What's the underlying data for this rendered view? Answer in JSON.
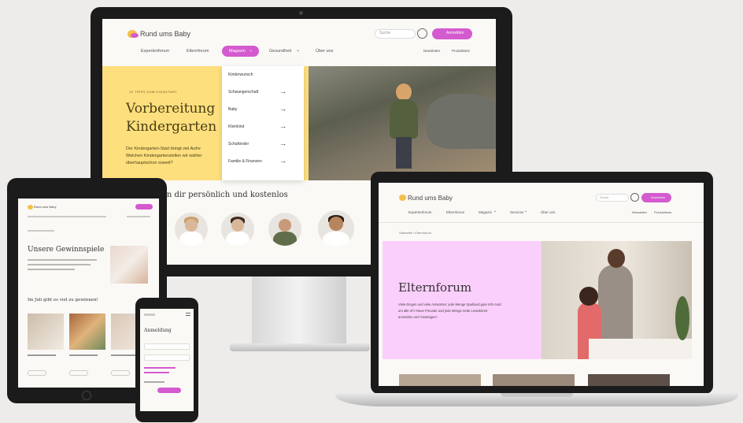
{
  "brand": "Rund ums Baby",
  "colors": {
    "accent": "#d45ad0",
    "yellow": "#fddf7e",
    "pink": "#fbcffb",
    "frame": "#1b1b1b"
  },
  "monitor": {
    "search_placeholder": "Suche",
    "login_label": "Anmelden",
    "nav": [
      "Expertenforum",
      "Elternforum",
      "Magazin",
      "Gesundheit",
      "Über uns"
    ],
    "nav_right": [
      "Newsletter",
      "Produkttest"
    ],
    "dropdown": [
      "Kinderwunsch",
      "Schwangerschaft",
      "Baby",
      "Kleinkind",
      "Schulkinder",
      "Familie & Finanzen"
    ],
    "hero_kicker": "10 TIPPS ZUM KIGASTART",
    "hero_title_1": "Vorbereitung",
    "hero_title_2": "Kindergarten",
    "hero_text_1": "Der Kindergarten-Start bringt viel Aufre",
    "hero_text_2": "Welchen Kindergartenstellen wir wähler",
    "hero_text_3": "überhauptschon soweit?",
    "experts_heading": "en dir persönlich und kostenlos"
  },
  "laptop": {
    "search_placeholder": "Suche",
    "login_label": "Anmelden",
    "nav": [
      "Expertenforum",
      "Elternforum",
      "Magazin",
      "Services",
      "Über uns"
    ],
    "nav_right": [
      "Newsletter",
      "Produkttests"
    ],
    "breadcrumb": "Startseite  /  Elternforum",
    "title": "Elternforum",
    "text_1": "Viele Eingen und viele Antworten: jede Menge Spaßund gute Info rund",
    "text_2": "um alle of t! Neue Freunde und jede Menge nette Leutekönnt",
    "text_3": "anmelden und 'einsteigen'!"
  },
  "tablet": {
    "title": "Unsere Gewinnspiele",
    "subtitle": "Im Juli gibt es viel zu gewinnen!",
    "card_text": "Artikel title",
    "button_label": "Zum Gewinn"
  },
  "phone": {
    "title": "Anmeldung",
    "button_label": "Anmelden"
  }
}
